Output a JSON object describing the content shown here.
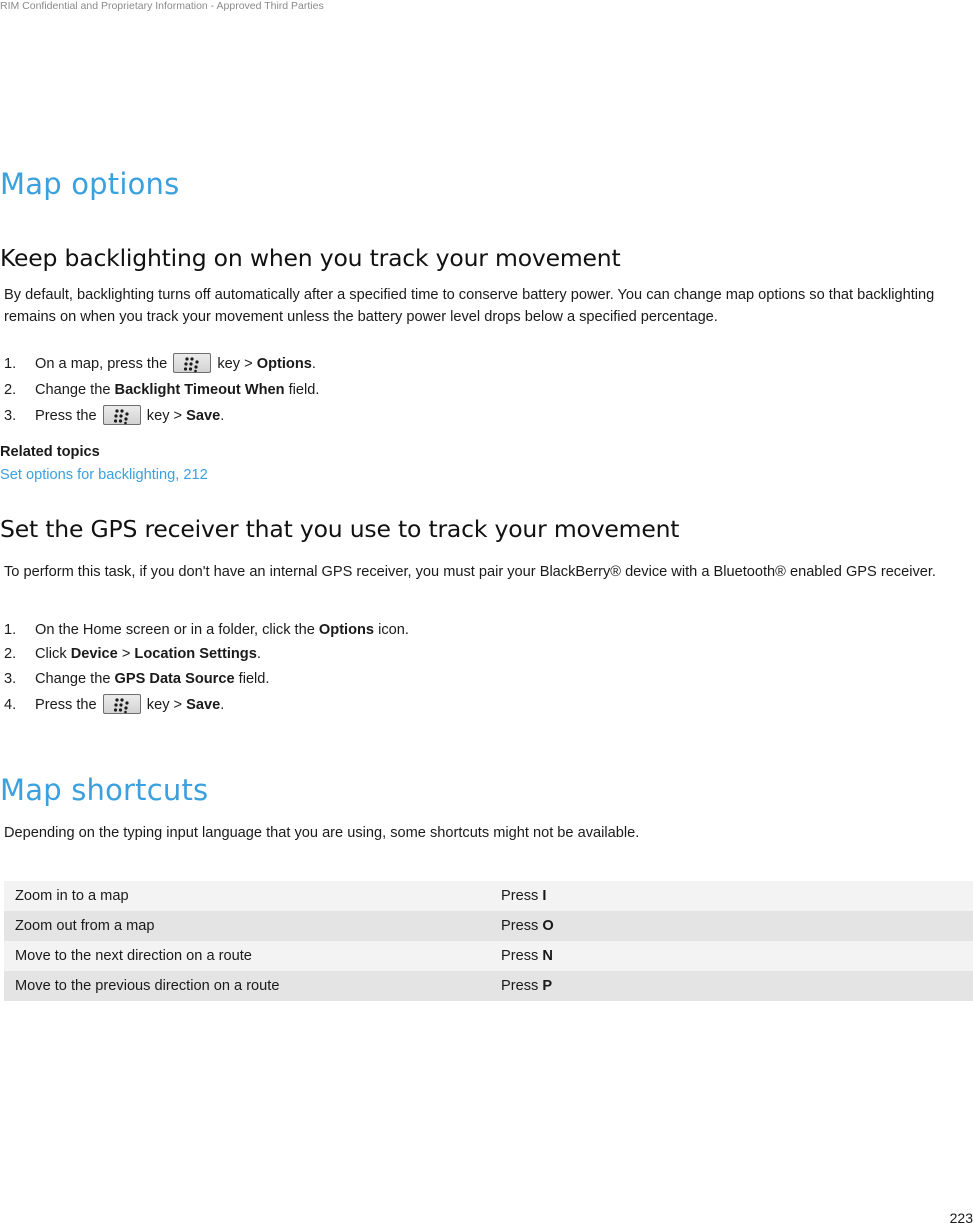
{
  "header": {
    "confidential_notice": "RIM Confidential and Proprietary Information - Approved Third Parties"
  },
  "sections": {
    "map_options": {
      "title": "Map options",
      "backlighting": {
        "title": "Keep backlighting on when you track your movement",
        "description": "By default, backlighting turns off automatically after a specified time to conserve battery power. You can change map options so that backlighting remains on when you track your movement unless the battery power level drops below a specified percentage.",
        "steps": [
          {
            "num": "1.",
            "before": "On a map, press the",
            "key_icon": "blackberry-menu-key-icon",
            "after": "key >",
            "bold": "Options",
            "end": "."
          },
          {
            "num": "2.",
            "before": "Change the",
            "bold": "Backlight Timeout When",
            "end": "field."
          },
          {
            "num": "3.",
            "before": "Press the",
            "key_icon": "blackberry-menu-key-icon",
            "after": "key >",
            "bold": "Save",
            "end": "."
          }
        ],
        "related_topics": {
          "title": "Related topics",
          "links": [
            "Set options for backlighting, 212"
          ]
        }
      },
      "gps_receiver": {
        "title": "Set the GPS receiver that you use to track your movement",
        "description": "To perform this task, if you don't have an internal GPS receiver, you must pair your BlackBerry® device with a Bluetooth® enabled GPS receiver.",
        "steps": [
          {
            "num": "1.",
            "before": "On the Home screen or in a folder, click the",
            "bold": "Options",
            "end": "icon."
          },
          {
            "num": "2.",
            "before": "Click",
            "bold": "Device",
            "mid": ">",
            "bold2": "Location Settings",
            "end": "."
          },
          {
            "num": "3.",
            "before": "Change the",
            "bold": "GPS Data Source",
            "end": "field."
          },
          {
            "num": "4.",
            "before": "Press the",
            "key_icon": "blackberry-menu-key-icon",
            "after": "key >",
            "bold": "Save",
            "end": "."
          }
        ]
      }
    },
    "map_shortcuts": {
      "title": "Map shortcuts",
      "description": "Depending on the typing input language that you are using, some shortcuts might not be available.",
      "rows": [
        {
          "action": "Zoom in to a map",
          "prefix": "Press",
          "key": "I"
        },
        {
          "action": "Zoom out from a map",
          "prefix": "Press",
          "key": "O"
        },
        {
          "action": "Move to the next direction on a route",
          "prefix": "Press",
          "key": "N"
        },
        {
          "action": "Move to the previous direction on a route",
          "prefix": "Press",
          "key": "P"
        }
      ]
    }
  },
  "footer": {
    "page_number": "223"
  },
  "colors": {
    "heading_blue": "#3aa0de",
    "link_blue": "#3aa0de",
    "row_light": "#f3f3f3",
    "row_dark": "#e4e4e4"
  }
}
